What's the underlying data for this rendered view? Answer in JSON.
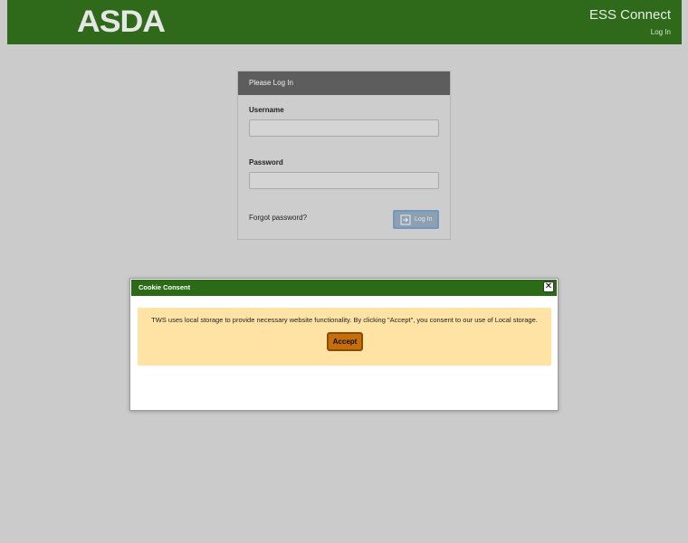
{
  "header": {
    "logo": "ASDA",
    "app_title": "ESS Connect",
    "login_link": "Log In"
  },
  "login_panel": {
    "title": "Please Log In",
    "username_label": "Username",
    "username_value": "",
    "password_label": "Password",
    "password_value": "",
    "forgot_label": "Forgot password?",
    "login_button": "Log In"
  },
  "cookie_modal": {
    "title": "Cookie Consent",
    "close_symbol": "✕",
    "message": "TWS uses local storage to provide necessary website functionality. By clicking \"Accept\", you consent to our use of Local storage.",
    "accept_label": "Accept"
  },
  "colors": {
    "header_bg": "#2f6a1b",
    "page_bg": "#cbcbcb",
    "panel_head_bg": "#5d5d5d",
    "modal_head_bg": "#2b6a16",
    "consent_bg": "#ffe3a4",
    "accept_bg": "#c66d0c"
  },
  "icons": {
    "login_button_icon": "sign-in-icon",
    "close_icon": "close-icon"
  }
}
